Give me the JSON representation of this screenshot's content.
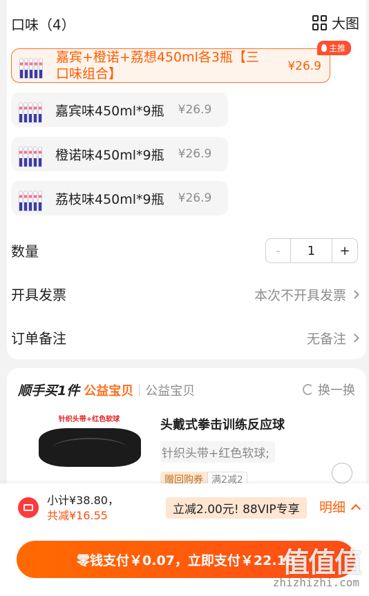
{
  "flavor": {
    "title": "口味（4）",
    "big_image_label": "大图",
    "hot_badge": "主推",
    "options": [
      {
        "label": "嘉宾+橙诺+荔想450ml各3瓶【三口味组合】",
        "price": "¥26.9",
        "selected": true
      },
      {
        "label": "嘉宾味450ml*9瓶",
        "price": "¥26.9",
        "selected": false
      },
      {
        "label": "橙诺味450ml*9瓶",
        "price": "¥26.9",
        "selected": false
      },
      {
        "label": "荔枝味450ml*9瓶",
        "price": "¥26.9",
        "selected": false
      }
    ]
  },
  "quantity": {
    "label": "数量",
    "minus": "-",
    "value": "1",
    "plus": "+"
  },
  "invoice": {
    "label": "开具发票",
    "value": "本次不开具发票"
  },
  "note": {
    "label": "订单备注",
    "value": "无备注"
  },
  "addon": {
    "title_em": "顺手买1件",
    "title_tag": "公益宝贝",
    "subtitle": "公益宝贝",
    "swap_label": "换一换",
    "image_caption": "针织头带+红色软球",
    "product_name": "头戴式拳击训练反应球",
    "sku": "针织头带+红色软球;",
    "gift_tag_a": "赠回购券",
    "gift_tag_b": "满2减2"
  },
  "footer": {
    "subtotal": "小计¥38.80，",
    "total_discount": "共减¥16.55",
    "promo": "立减2.00元! 88VIP专享",
    "detail_label": "明细",
    "pay_button": "零钱支付￥0.07，立即支付￥22.18"
  },
  "watermark": {
    "text": "值值值",
    "url": "zhizhizhi.com"
  },
  "colors": {
    "accent": "#ff5b00",
    "badge": "#ff4f2e",
    "promo_bg": "#ffe6d2"
  }
}
